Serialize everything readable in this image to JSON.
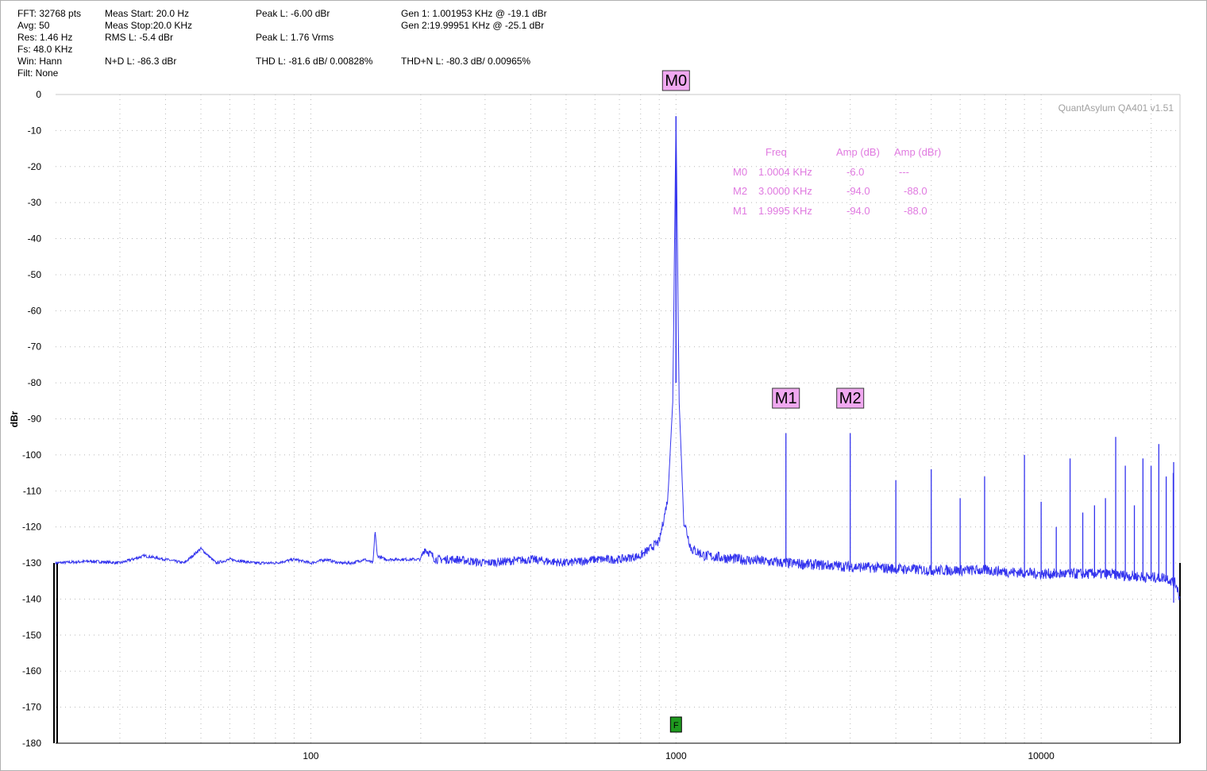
{
  "info": {
    "col1": [
      "FFT: 32768 pts",
      "Avg: 50",
      "Res: 1.46 Hz",
      "Fs: 48.0 KHz",
      "Win: Hann",
      "Filt: None"
    ],
    "col2": [
      "Meas Start: 20.0 Hz",
      "Meas Stop:20.0 KHz",
      "RMS L: -5.4 dBr",
      "N+D L: -86.3 dBr"
    ],
    "col3": [
      "Peak L: -6.00 dBr",
      "Peak L: 1.76 Vrms",
      "THD L: -81.6 dB/ 0.00828%"
    ],
    "col4": [
      "Gen 1: 1.001953 KHz @ -19.1  dBr",
      "Gen 2:19.99951 KHz @ -25.1  dBr",
      "THD+N L: -80.3 dB/ 0.00965%"
    ]
  },
  "watermark": "QuantAsylum QA401 v1.51",
  "marker_table": {
    "headers": [
      "Freq",
      "Amp (dB)",
      "Amp (dBr)"
    ],
    "rows": [
      {
        "name": "M0",
        "freq": "1.0004 KHz",
        "amp_db": "-6.0",
        "amp_dbr": "---"
      },
      {
        "name": "M2",
        "freq": "3.0000 KHz",
        "amp_db": "-94.0",
        "amp_dbr": "-88.0"
      },
      {
        "name": "M1",
        "freq": "1.9995 KHz",
        "amp_db": "-94.0",
        "amp_dbr": "-88.0"
      }
    ]
  },
  "colors": {
    "trace": "#3333ee",
    "marker_bg": "#f0a8f0",
    "table_text": "#e07ae0",
    "f_marker": "#1f9a1f"
  },
  "chart_data": {
    "type": "line",
    "title": "",
    "xlabel": "",
    "ylabel": "dBr",
    "x_scale": "log",
    "xlim": [
      20,
      24000
    ],
    "ylim": [
      -180,
      0
    ],
    "grid": true,
    "x_ticks": [
      100,
      1000,
      10000
    ],
    "y_ticks": [
      0,
      -10,
      -20,
      -30,
      -40,
      -50,
      -60,
      -70,
      -80,
      -90,
      -100,
      -110,
      -120,
      -130,
      -140,
      -150,
      -160,
      -170,
      -180
    ],
    "series": [
      {
        "x": [
          20,
          25,
          30,
          35,
          40,
          45,
          50,
          55,
          60,
          70,
          80,
          90,
          100,
          110,
          120,
          130,
          140,
          148,
          150,
          152,
          160,
          180,
          200,
          205,
          220,
          250,
          300,
          400,
          500,
          600,
          700,
          800,
          900,
          950,
          980,
          1000,
          1020,
          1050,
          1100,
          1200,
          1500,
          2000,
          3000,
          5000,
          7000,
          10000,
          15000,
          20000,
          22000,
          23500,
          24000
        ],
        "y": [
          -130,
          -129.5,
          -130,
          -128,
          -129,
          -130,
          -126,
          -130,
          -129,
          -130,
          -130,
          -129,
          -130,
          -129,
          -130,
          -130,
          -129,
          -130,
          -121,
          -128,
          -129,
          -129,
          -129,
          -126,
          -129,
          -129,
          -130,
          -129,
          -130,
          -129,
          -129,
          -128,
          -124,
          -112,
          -85,
          -6,
          -85,
          -118,
          -126,
          -128,
          -129,
          -130,
          -131,
          -132,
          -132,
          -133,
          -133,
          -134,
          -134,
          -136,
          -140
        ]
      }
    ],
    "harmonics": [
      {
        "x": 2000,
        "y": -94
      },
      {
        "x": 3000,
        "y": -94
      },
      {
        "x": 4000,
        "y": -107
      },
      {
        "x": 5000,
        "y": -104
      },
      {
        "x": 6000,
        "y": -112
      },
      {
        "x": 7000,
        "y": -106
      },
      {
        "x": 9000,
        "y": -100
      },
      {
        "x": 10000,
        "y": -113
      },
      {
        "x": 11000,
        "y": -120
      },
      {
        "x": 12000,
        "y": -101
      },
      {
        "x": 13000,
        "y": -116
      },
      {
        "x": 14000,
        "y": -114
      },
      {
        "x": 15000,
        "y": -112
      },
      {
        "x": 16000,
        "y": -95
      },
      {
        "x": 17000,
        "y": -103
      },
      {
        "x": 18000,
        "y": -114
      },
      {
        "x": 19000,
        "y": -101
      },
      {
        "x": 20000,
        "y": -103
      },
      {
        "x": 21000,
        "y": -97
      },
      {
        "x": 22000,
        "y": -106
      },
      {
        "x": 23000,
        "y": -105
      },
      {
        "x": 24000,
        "y": -102
      }
    ],
    "markers": [
      {
        "name": "M0",
        "x": 1000,
        "y": -6
      },
      {
        "name": "M1",
        "x": 2000,
        "y": -94
      },
      {
        "name": "M2",
        "x": 3000,
        "y": -94
      }
    ],
    "f_marker": {
      "label": "F",
      "x": 1000
    }
  }
}
